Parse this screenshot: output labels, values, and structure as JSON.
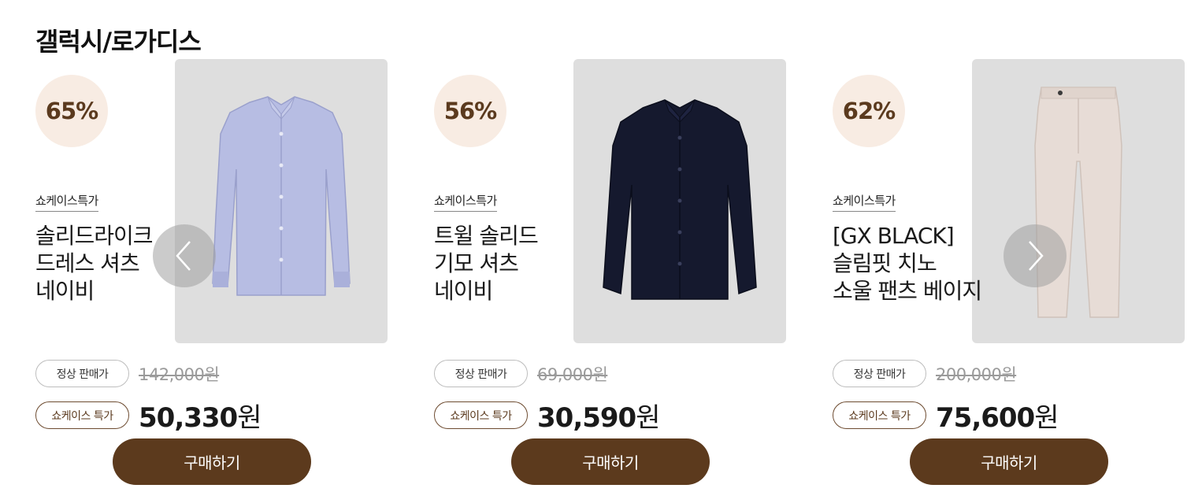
{
  "section": {
    "title": "갤럭시/로가디스"
  },
  "products": [
    {
      "discount": "65%",
      "tag": "쇼케이스특가",
      "name_lines": [
        "솔리드라이크",
        "드레스 셔츠",
        "네이비"
      ],
      "regular_label": "정상 판매가",
      "regular_price": "142,000원",
      "special_label": "쇼케이스 특가",
      "sale_price_number": "50,330",
      "sale_price_unit": "원",
      "buy_label": "구매하기",
      "image": "light-blue-dress-shirt"
    },
    {
      "discount": "56%",
      "tag": "쇼케이스특가",
      "name_lines": [
        "트윌 솔리드",
        "기모 셔츠",
        "네이비"
      ],
      "regular_label": "정상 판매가",
      "regular_price": "69,000원",
      "special_label": "쇼케이스 특가",
      "sale_price_number": "30,590",
      "sale_price_unit": "원",
      "buy_label": "구매하기",
      "image": "navy-dress-shirt"
    },
    {
      "discount": "62%",
      "tag": "쇼케이스특가",
      "name_lines": [
        "[GX BLACK]",
        "슬림핏 치노",
        "소울 팬츠 베이지"
      ],
      "regular_label": "정상 판매가",
      "regular_price": "200,000원",
      "special_label": "쇼케이스 특가",
      "sale_price_number": "75,600",
      "sale_price_unit": "원",
      "buy_label": "구매하기",
      "image": "beige-chino-pants"
    }
  ],
  "carousel": {
    "prev_icon": "chevron-left-icon",
    "next_icon": "chevron-right-icon"
  },
  "colors": {
    "accent_brown": "#5c3a1d",
    "badge_bg": "#f8ece3",
    "image_bg": "#dedede"
  }
}
